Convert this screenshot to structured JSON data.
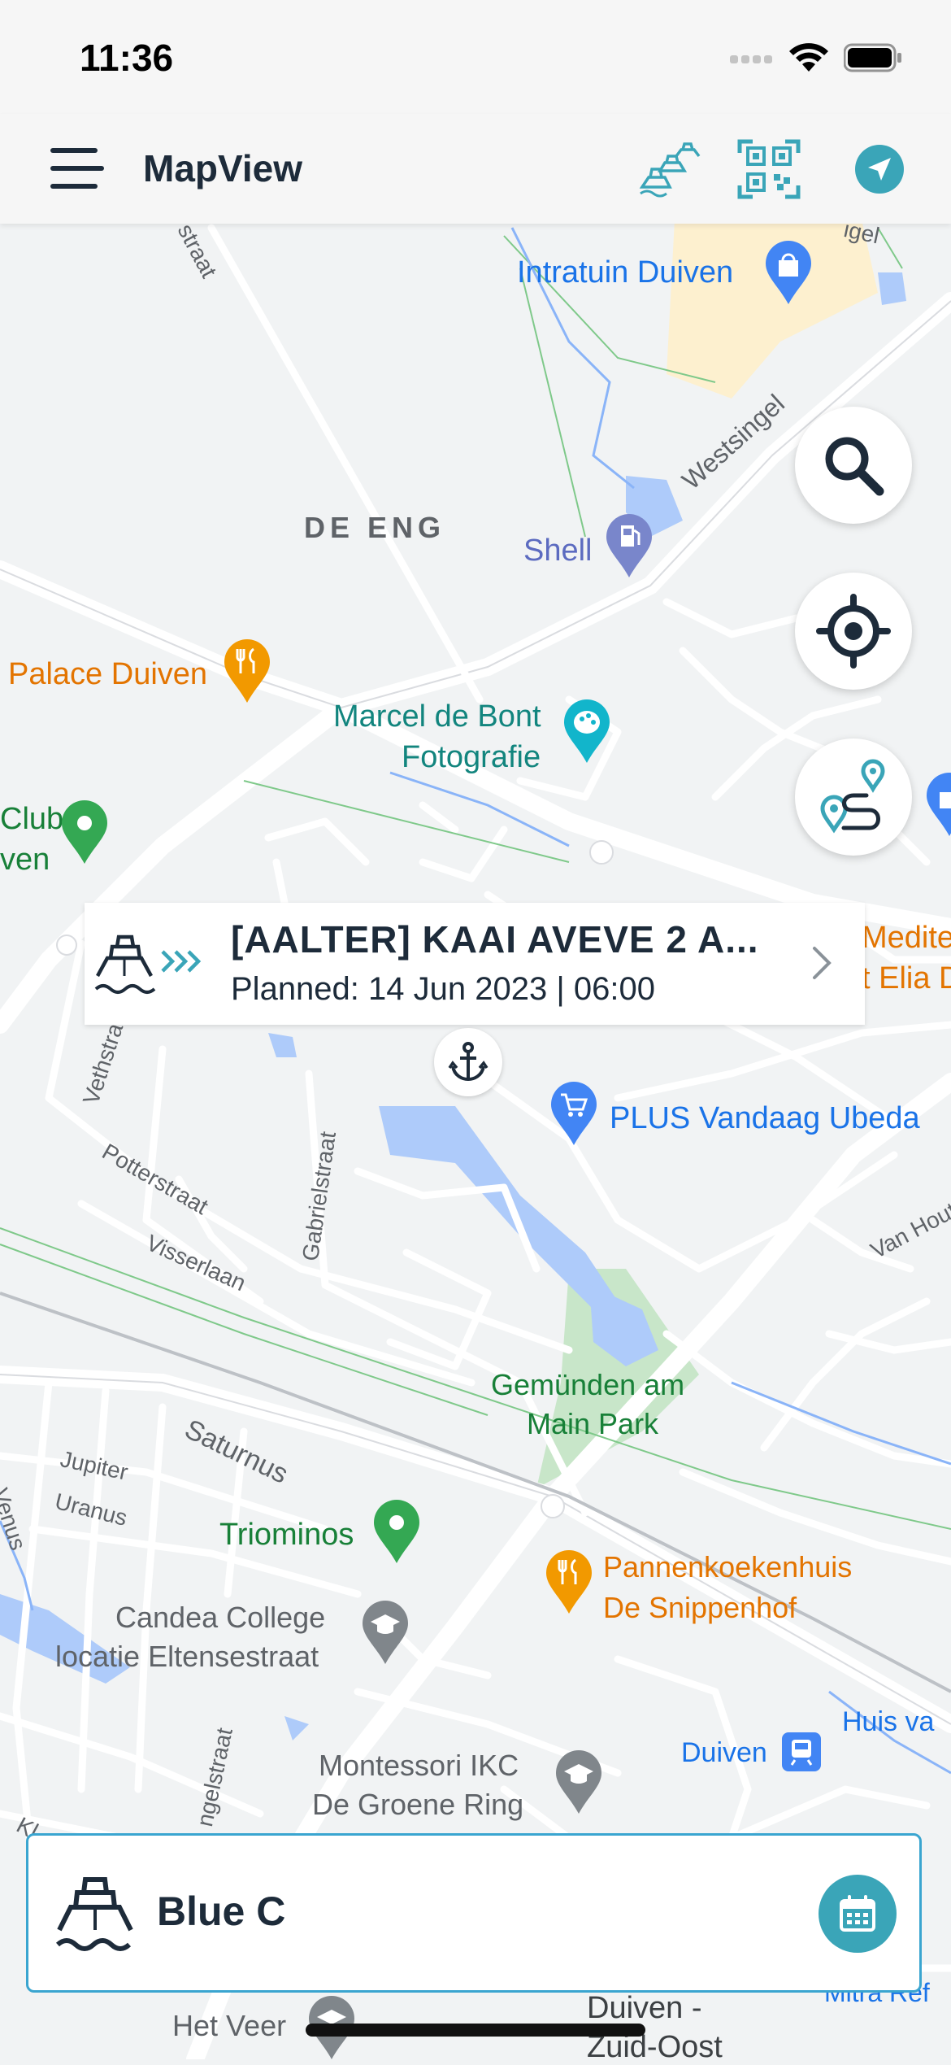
{
  "status_bar": {
    "time": "11:36"
  },
  "header": {
    "title": "MapView"
  },
  "voyage_card": {
    "title": "[AALTER] KAAI AVEVE 2 A...",
    "subtitle": "Planned: 14 Jun 2023 | 06:00"
  },
  "bottom_card": {
    "vessel_name": "Blue C"
  },
  "map_labels": {
    "area": "DE ENG",
    "intratuin": "Intratuin Duiven",
    "shell": "Shell",
    "westsingel": "Westsingel",
    "palace": "Palace Duiven",
    "marcel_1": "Marcel de Bont",
    "marcel_2": "Fotografie",
    "club_1": "Club",
    "club_2": "ven",
    "medite_1": "Medite",
    "medite_2": "t Elia D",
    "plus": "PLUS Vandaag Ubeda",
    "potterstraat": "Potterstraat",
    "vethstraat": "Vethstra",
    "gabrielstraat": "Gabrielstraat",
    "visserlaan": "Visserlaan",
    "van_hout": "Van Hout",
    "gemunden_1": "Gemünden am",
    "gemunden_2": "Main Park",
    "saturnus": "Saturnus",
    "jupiter": "Jupiter",
    "uranus": "Uranus",
    "venus": "Venus",
    "triominos": "Triominos",
    "pannen_1": "Pannenkoekenhuis",
    "pannen_2": "De Snippenhof",
    "candea_1": "Candea College",
    "candea_2": "locatie Eltensestraat",
    "duiven_station": "Duiven",
    "huis": "Huis va",
    "montessori_1": "Montessori IKC",
    "montessori_2": "De Groene Ring",
    "engelstraat": "ngelstraat",
    "kl": "Kl",
    "het_veer": "Het Veer",
    "duiven_zuid_1": "Duiven -",
    "duiven_zuid_2": "Zuid-Oost",
    "mitra": "Mitra Ref",
    "straat_top": "straat",
    "igel": "igel"
  },
  "colors": {
    "accent": "#3aa5b8",
    "dark_navy": "#1d2b3a",
    "map_background": "#f1f3f4",
    "water": "#aecbfa",
    "park": "#c8e6c9",
    "commercial": "#fdf0cf"
  }
}
